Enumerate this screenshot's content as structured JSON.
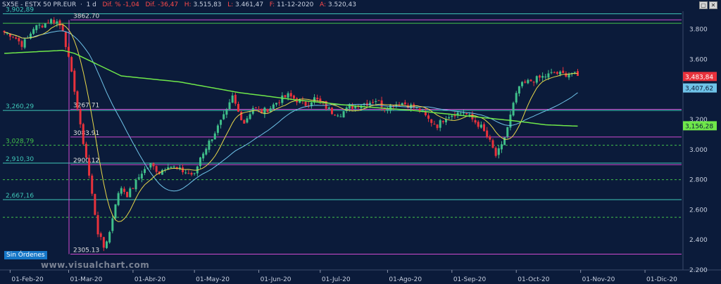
{
  "header": {
    "symbol": "SX5E - ESTX 50 PR.EUR",
    "timeframe": "1 d",
    "change_pct_label": "Dif. %",
    "change_pct": "-1,04",
    "change_label": "Dif.",
    "change": "-36,47",
    "high_label": "H:",
    "high": "3.515,83",
    "low_label": "L:",
    "low": "3.461,47",
    "date_label": "F:",
    "date": "11-12-2020",
    "open_label": "A:",
    "open": "3.520,43"
  },
  "window_buttons": [
    "▢",
    "✕"
  ],
  "status_badge": "Sin Órdenes",
  "watermark": "www.visualchart.com",
  "colors": {
    "background": "#0b1b3a",
    "up_candle": "#3fbf8a",
    "down_candle": "#e8323c",
    "sma_fast": "#e8d84a",
    "sma_mid": "#6fc3e8",
    "sma_slow": "#6fe84a",
    "level_cyan": "#3fc7b8",
    "level_green_dashed": "#44c24a",
    "level_magenta": "#d04ad0",
    "last_price_box": "#e8323c",
    "sma_mid_box": "#6fc3e8",
    "sma_slow_box": "#6fe84a"
  },
  "chart_data": {
    "type": "candlestick",
    "ylim": [
      3270,
      3920
    ],
    "y_ticks": [
      3300,
      3400,
      3600,
      3800
    ],
    "y_tick_labels": [
      "3.800",
      "3.600",
      "3.400",
      "3.200",
      "3.000",
      "2.800",
      "2.600",
      "2.400",
      "2.200"
    ],
    "y_tick_values": [
      3800,
      3600,
      3400,
      3200,
      3000,
      2800,
      2600,
      2400,
      2200
    ],
    "price_scale": [
      2200,
      3920
    ],
    "x_labels": [
      "01-Feb-20",
      "01-Mar-20",
      "01-Abr-20",
      "01-May-20",
      "01-Jun-20",
      "01-Jul-20",
      "01-Ago-20",
      "01-Sep-20",
      "01-Oct-20",
      "01-Nov-20",
      "01-Dic-20"
    ],
    "x_label_index": [
      2,
      22,
      44,
      65,
      87,
      108,
      131,
      153,
      175,
      197,
      219
    ],
    "num_bars": 232,
    "levels": [
      {
        "value": 3902.89,
        "label": "3,902,89",
        "style": "cyan",
        "side": "left"
      },
      {
        "value": 3862.7,
        "label": "3862.70",
        "style": "magenta",
        "side": "center"
      },
      {
        "value": 3840,
        "label": "",
        "style": "green_solid",
        "side": ""
      },
      {
        "value": 3267.71,
        "label": "3267.71",
        "style": "magenta",
        "side": "center"
      },
      {
        "value": 3260.29,
        "label": "3,260,29",
        "style": "cyan",
        "side": "left"
      },
      {
        "value": 3083.91,
        "label": "3083.91",
        "style": "magenta",
        "side": "center"
      },
      {
        "value": 3028.79,
        "label": "3,028,79",
        "style": "green_dashed",
        "side": "left"
      },
      {
        "value": 2900.12,
        "label": "2900.12",
        "style": "magenta",
        "side": "center"
      },
      {
        "value": 2910.3,
        "label": "2,910,30",
        "style": "cyan",
        "side": "left"
      },
      {
        "value": 2800,
        "label": "",
        "style": "green_dashed",
        "side": ""
      },
      {
        "value": 2667.16,
        "label": "2,667,16",
        "style": "cyan",
        "side": "left"
      },
      {
        "value": 2550,
        "label": "",
        "style": "green_dashed",
        "side": ""
      },
      {
        "value": 2305.13,
        "label": "2305.13",
        "style": "magenta",
        "side": "center"
      }
    ],
    "price_boxes": [
      {
        "value": 3483.84,
        "label": "3,483,84",
        "kind": "last"
      },
      {
        "value": 3407.62,
        "label": "3,407,62",
        "kind": "sma_mid"
      },
      {
        "value": 3156.28,
        "label": "3,156,28",
        "kind": "sma_slow"
      }
    ],
    "closes_keypoints": [
      [
        0,
        3780
      ],
      [
        3,
        3760
      ],
      [
        6,
        3700
      ],
      [
        8,
        3740
      ],
      [
        10,
        3810
      ],
      [
        13,
        3830
      ],
      [
        16,
        3860
      ],
      [
        18,
        3850
      ],
      [
        20,
        3800
      ],
      [
        22,
        3600
      ],
      [
        24,
        3400
      ],
      [
        26,
        3150
      ],
      [
        28,
        2950
      ],
      [
        30,
        2700
      ],
      [
        32,
        2450
      ],
      [
        34,
        2350
      ],
      [
        36,
        2450
      ],
      [
        38,
        2650
      ],
      [
        40,
        2750
      ],
      [
        42,
        2700
      ],
      [
        44,
        2750
      ],
      [
        47,
        2850
      ],
      [
        50,
        2900
      ],
      [
        53,
        2850
      ],
      [
        56,
        2900
      ],
      [
        59,
        2870
      ],
      [
        62,
        2850
      ],
      [
        65,
        2830
      ],
      [
        67,
        2950
      ],
      [
        70,
        3050
      ],
      [
        73,
        3150
      ],
      [
        76,
        3250
      ],
      [
        78,
        3350
      ],
      [
        80,
        3250
      ],
      [
        82,
        3180
      ],
      [
        85,
        3280
      ],
      [
        88,
        3250
      ],
      [
        91,
        3280
      ],
      [
        94,
        3330
      ],
      [
        97,
        3360
      ],
      [
        100,
        3330
      ],
      [
        103,
        3300
      ],
      [
        106,
        3340
      ],
      [
        109,
        3300
      ],
      [
        112,
        3250
      ],
      [
        115,
        3240
      ],
      [
        118,
        3280
      ],
      [
        121,
        3300
      ],
      [
        124,
        3310
      ],
      [
        127,
        3330
      ],
      [
        130,
        3280
      ],
      [
        133,
        3300
      ],
      [
        136,
        3310
      ],
      [
        139,
        3290
      ],
      [
        142,
        3260
      ],
      [
        145,
        3200
      ],
      [
        148,
        3160
      ],
      [
        151,
        3220
      ],
      [
        154,
        3240
      ],
      [
        157,
        3250
      ],
      [
        160,
        3200
      ],
      [
        163,
        3150
      ],
      [
        166,
        3050
      ],
      [
        168,
        2960
      ],
      [
        170,
        3020
      ],
      [
        172,
        3150
      ],
      [
        174,
        3300
      ],
      [
        176,
        3420
      ],
      [
        179,
        3450
      ],
      [
        182,
        3470
      ],
      [
        185,
        3490
      ],
      [
        188,
        3510
      ],
      [
        191,
        3500
      ],
      [
        194,
        3510
      ],
      [
        196,
        3483.84
      ]
    ],
    "sma_slow_keypoints": [
      [
        0,
        3640
      ],
      [
        20,
        3660
      ],
      [
        24,
        3640
      ],
      [
        40,
        3490
      ],
      [
        60,
        3450
      ],
      [
        80,
        3380
      ],
      [
        100,
        3330
      ],
      [
        120,
        3290
      ],
      [
        140,
        3260
      ],
      [
        160,
        3220
      ],
      [
        175,
        3190
      ],
      [
        185,
        3165
      ],
      [
        196,
        3156.28
      ]
    ]
  }
}
